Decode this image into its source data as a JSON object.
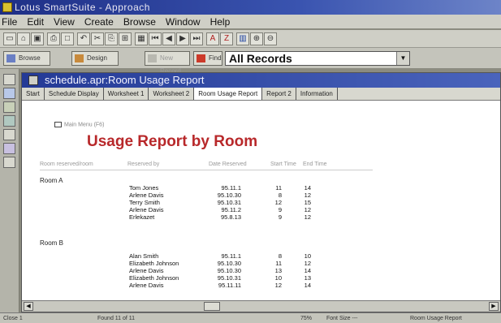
{
  "window": {
    "title": "Lotus SmartSuite - Approach"
  },
  "menu": [
    "File",
    "Edit",
    "View",
    "Create",
    "Browse",
    "Window",
    "Help"
  ],
  "action_bar": {
    "browse": "Browse",
    "design": "Design",
    "new_record": "New Record",
    "find": "Find",
    "find_set": "All Records"
  },
  "document": {
    "title": "schedule.apr:Room Usage Report",
    "tabs": [
      "Start",
      "Schedule Display",
      "Worksheet 1",
      "Worksheet 2",
      "Room Usage Report",
      "Report 2",
      "Information"
    ],
    "active_tab": 4
  },
  "report": {
    "menu_link": "Main Menu (F6)",
    "title": "Usage Report by Room",
    "columns": [
      "Room reserved/room",
      "Reserved by",
      "Date Reserved",
      "Start Time",
      "End Time"
    ],
    "groups": [
      {
        "room": "Room A",
        "rows": [
          {
            "name": "Tom Jones",
            "date": "95.11.1",
            "start": "11",
            "end": "14"
          },
          {
            "name": "Arlene Davis",
            "date": "95.10.30",
            "start": "8",
            "end": "12"
          },
          {
            "name": "Terry Smith",
            "date": "95.10.31",
            "start": "12",
            "end": "15"
          },
          {
            "name": "Arlene Davis",
            "date": "95.11.2",
            "start": "9",
            "end": "12"
          },
          {
            "name": "Erlekazet",
            "date": "95.8.13",
            "start": "9",
            "end": "12"
          }
        ]
      },
      {
        "room": "Room B",
        "rows": [
          {
            "name": "Alan Smith",
            "date": "95.11.1",
            "start": "8",
            "end": "10"
          },
          {
            "name": "Elizabeth Johnson",
            "date": "95.10.30",
            "start": "11",
            "end": "12"
          },
          {
            "name": "Arlene Davis",
            "date": "95.10.30",
            "start": "13",
            "end": "14"
          },
          {
            "name": "Elizabeth Johnson",
            "date": "95.10.31",
            "start": "10",
            "end": "13"
          },
          {
            "name": "Arlene Davis",
            "date": "95.11.11",
            "start": "12",
            "end": "14"
          }
        ]
      }
    ]
  },
  "status": {
    "left": "Close 1",
    "found": "Found 11 of 11",
    "zoom": "75%",
    "font": "Font Size ---",
    "view": "Room Usage Report"
  },
  "colors": {
    "title_bar": "#1e2f86",
    "doc_title_bar": "#243a96",
    "report_title": "#b8282a",
    "chrome": "#cfcfc6"
  }
}
